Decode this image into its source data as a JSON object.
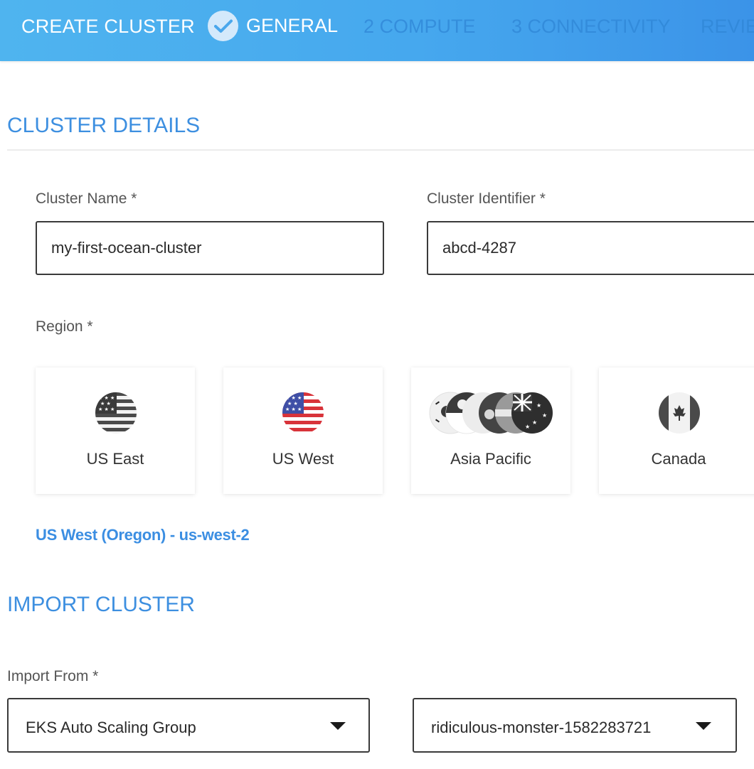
{
  "header": {
    "title": "CREATE CLUSTER",
    "steps": [
      {
        "label": "GENERAL",
        "state": "completed"
      },
      {
        "label": "2 COMPUTE",
        "state": "pending"
      },
      {
        "label": "3 CONNECTIVITY",
        "state": "pending"
      },
      {
        "label": "REVIEW",
        "state": "pending"
      }
    ]
  },
  "cluster_details": {
    "section_title": "CLUSTER DETAILS",
    "cluster_name": {
      "label": "Cluster Name *",
      "value": "my-first-ocean-cluster"
    },
    "cluster_identifier": {
      "label": "Cluster Identifier *",
      "value": "abcd-4287"
    },
    "region": {
      "label": "Region *",
      "options": [
        {
          "label": "US East",
          "icon": "us-flag-grayscale-icon"
        },
        {
          "label": "US West",
          "icon": "us-flag-icon"
        },
        {
          "label": "Asia Pacific",
          "icon": "asia-pacific-flags-icon"
        },
        {
          "label": "Canada",
          "icon": "canada-flag-grayscale-icon"
        }
      ],
      "selected": "US West (Oregon) - us-west-2"
    }
  },
  "import_cluster": {
    "section_title": "IMPORT CLUSTER",
    "import_from": {
      "label": "Import From *",
      "value": "EKS Auto Scaling Group"
    },
    "group": {
      "value": "ridiculous-monster-1582283721"
    }
  },
  "colors": {
    "accent": "#3d8fe0",
    "header_start": "#4fb4ef",
    "header_end": "#3b93e8"
  }
}
